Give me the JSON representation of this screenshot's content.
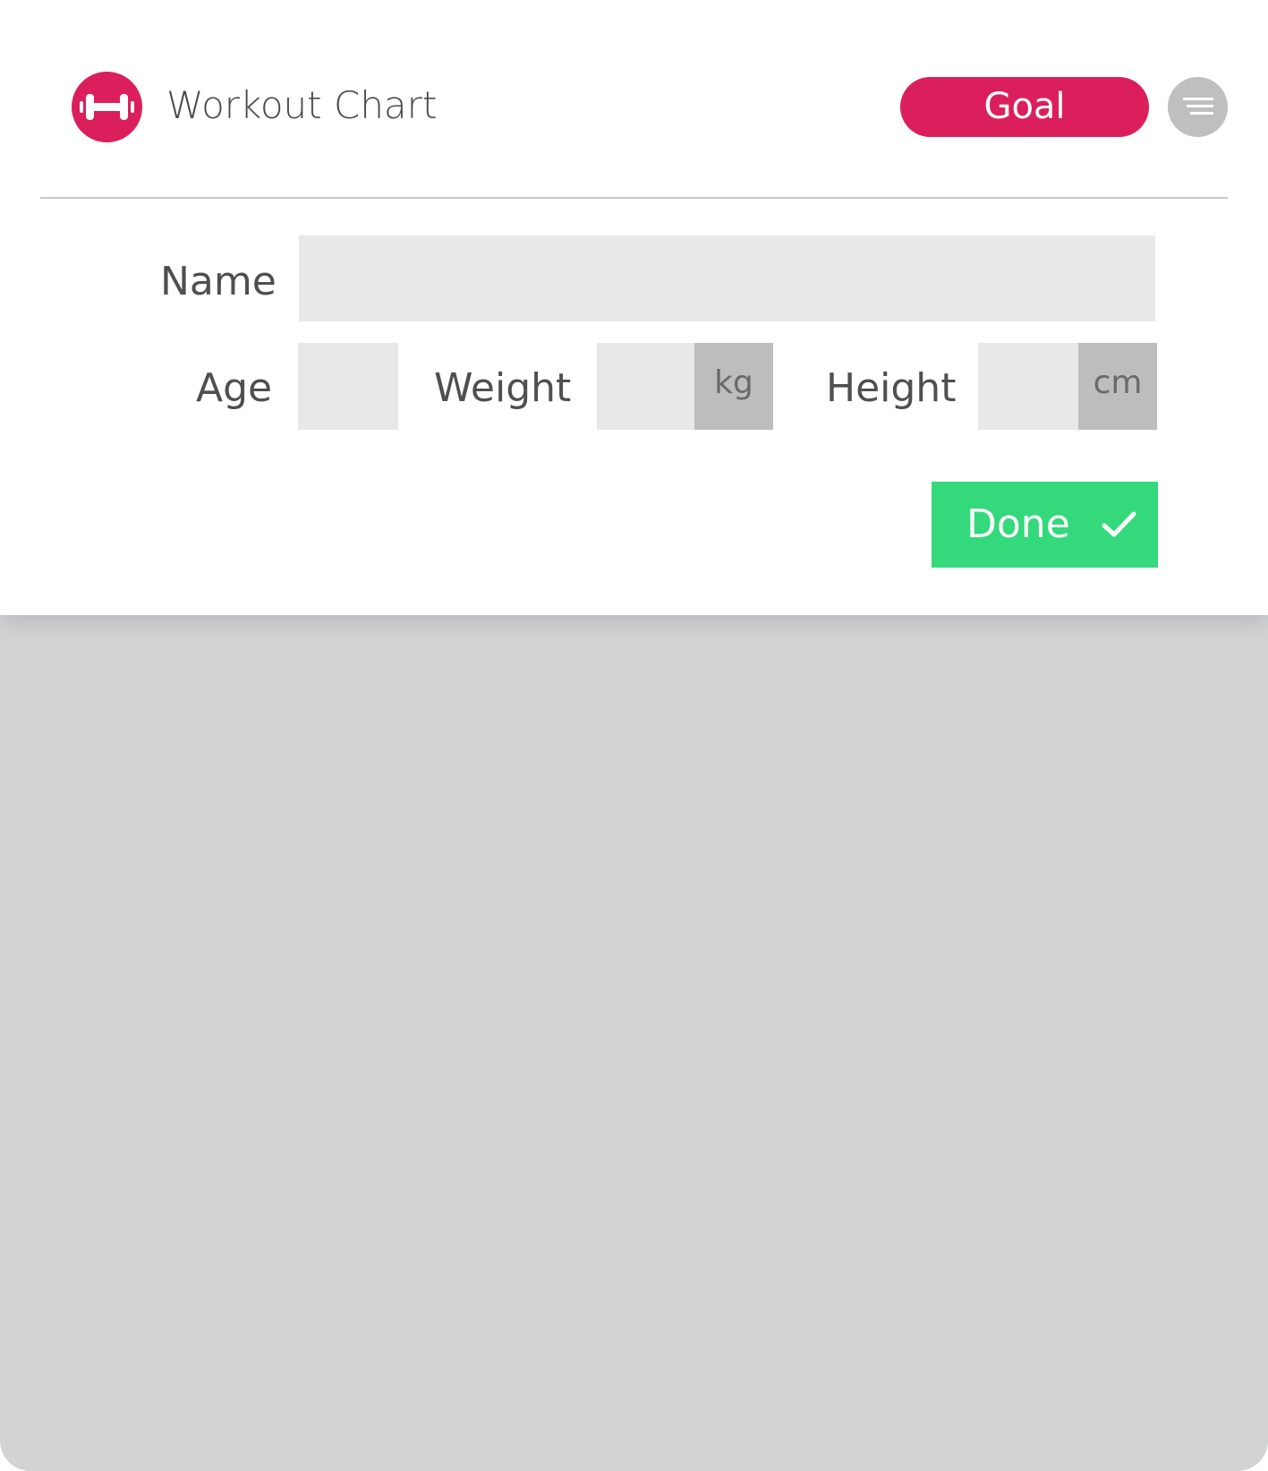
{
  "header": {
    "app_title": "Workout Chart",
    "logo_icon": "dumbbell-icon",
    "goal_label": "Goal",
    "menu_icon": "hamburger-menu-icon"
  },
  "form": {
    "name_label": "Name",
    "name_value": "",
    "age_label": "Age",
    "age_value": "",
    "weight_label": "Weight",
    "weight_value": "",
    "weight_unit": "kg",
    "height_label": "Height",
    "height_value": "",
    "height_unit": "cm"
  },
  "actions": {
    "done_label": "Done",
    "done_icon": "checkmark-icon"
  },
  "colors": {
    "brand": "#db1f5d",
    "done": "#33d97a",
    "input_bg": "#e8e8e8",
    "unit_bg": "#bdbdbe",
    "backdrop": "#d2d3d5"
  }
}
